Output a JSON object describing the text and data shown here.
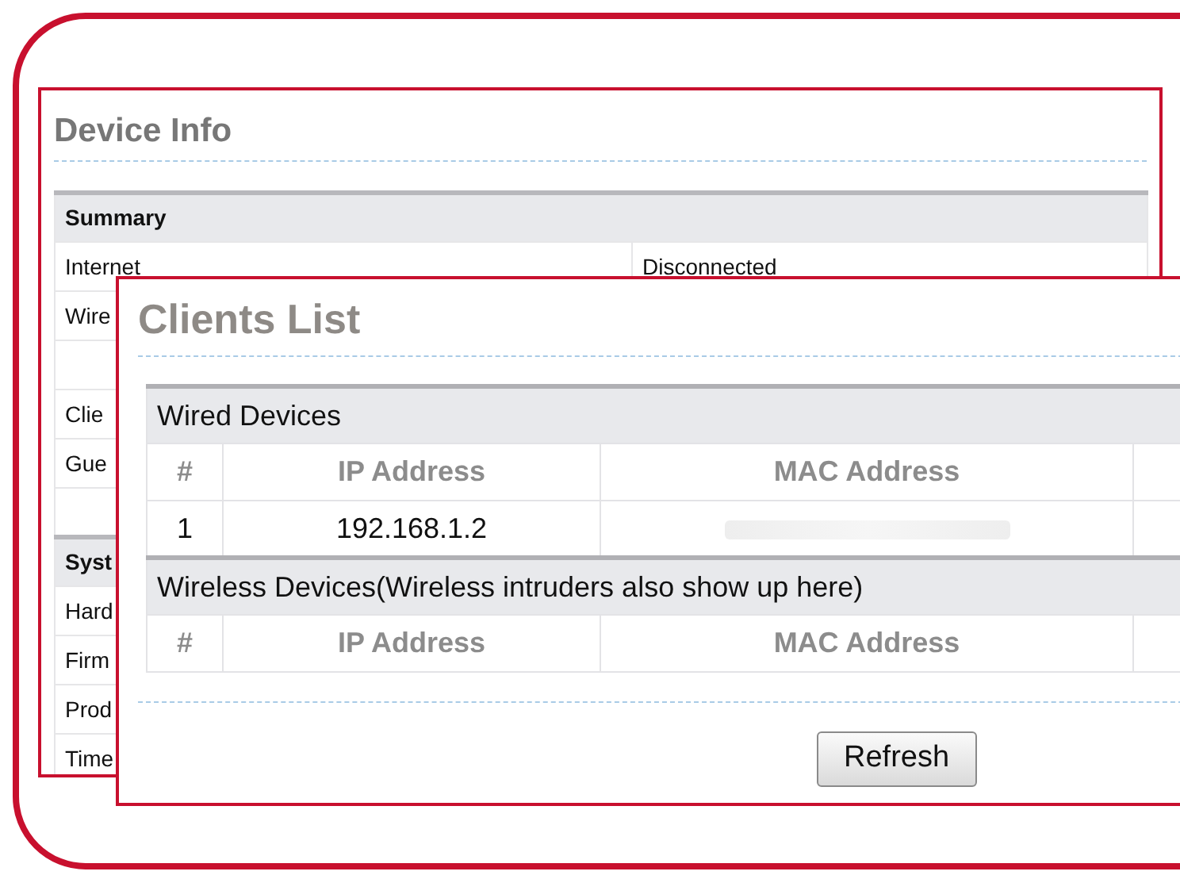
{
  "device_info": {
    "title": "Device Info",
    "sections": [
      {
        "heading": "Summary",
        "rows": [
          {
            "kind": "entry",
            "label": "Internet",
            "value": "Disconnected"
          },
          {
            "kind": "entry",
            "label": "Wire"
          },
          {
            "kind": "blank"
          },
          {
            "kind": "entry",
            "label": "Clie"
          },
          {
            "kind": "entry",
            "label": "Gue"
          },
          {
            "kind": "blank"
          }
        ]
      },
      {
        "heading": "Syst",
        "rows": [
          {
            "kind": "entry",
            "label": "Hard"
          },
          {
            "kind": "entry",
            "label": "Firm"
          },
          {
            "kind": "entry",
            "label": "Prod"
          },
          {
            "kind": "entry",
            "label": "Time"
          }
        ]
      }
    ]
  },
  "clients_list": {
    "title": "Clients List",
    "groups": [
      {
        "heading": "Wired Devices",
        "columns": [
          "#",
          "IP Address",
          "MAC Address"
        ],
        "rows": [
          {
            "cells": [
              "1",
              "192.168.1.2"
            ],
            "mac_redacted": true
          }
        ]
      },
      {
        "heading": "Wireless Devices(Wireless intruders also show up here)",
        "columns": [
          "#",
          "IP Address",
          "MAC Address"
        ]
      }
    ],
    "button": "Refresh"
  }
}
